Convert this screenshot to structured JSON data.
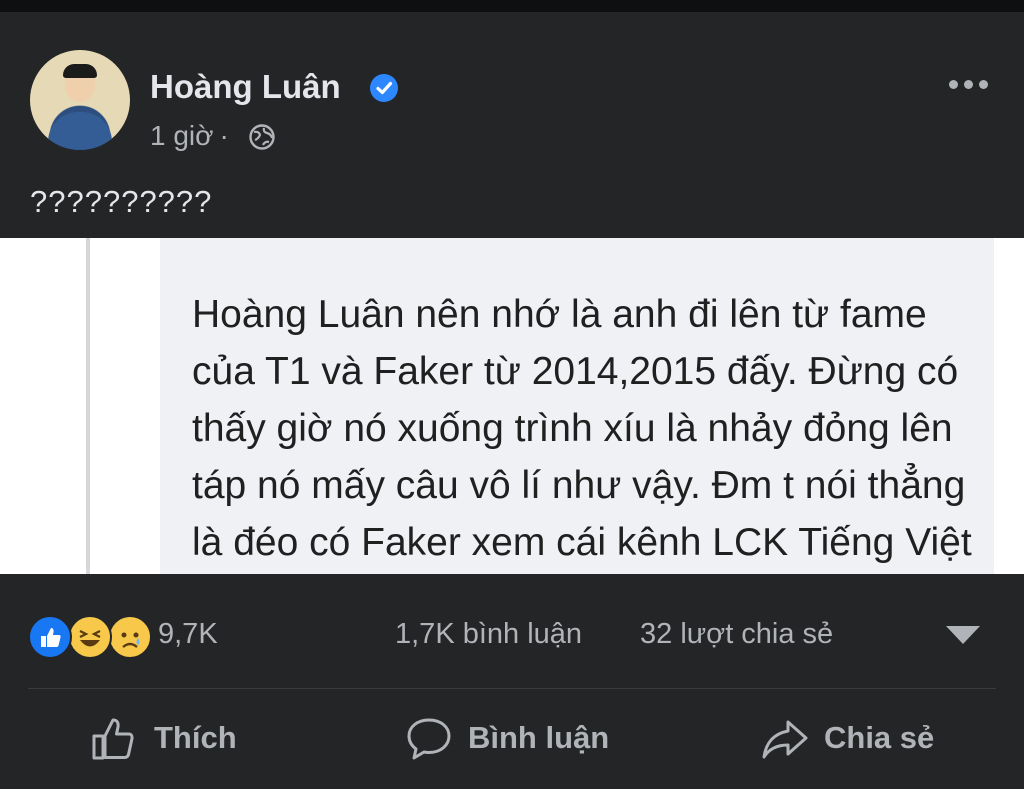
{
  "post": {
    "author": "Hoàng Luân",
    "time": "1 giờ",
    "separator": "·",
    "caption": "??????????",
    "icons": {
      "verified": "verified-badge-icon",
      "privacy": "globe-icon",
      "more": "more-options-icon"
    }
  },
  "image_text": "Hoàng Luân nên nhớ là anh đi lên từ fame của T1 và Faker từ 2014,2015 đấy. Đừng có thấy giờ nó xuống trình xíu là nhảy đỏng lên táp nó mấy câu vô lí như vậy. Đm t nói thẳng là đéo có Faker xem cái kênh LCK Tiếng Việt còn",
  "stats": {
    "reactions_count": "9,7K",
    "comments": "1,7K bình luận",
    "shares": "32 lượt chia sẻ",
    "reaction_icons": [
      "like-reaction-icon",
      "haha-reaction-icon",
      "sad-reaction-icon"
    ]
  },
  "actions": {
    "like": "Thích",
    "comment": "Bình luận",
    "share": "Chia sẻ"
  },
  "colors": {
    "background": "#242526",
    "text": "#e4e6eb",
    "muted": "#b0b3b8",
    "accent": "#2d88ff"
  }
}
